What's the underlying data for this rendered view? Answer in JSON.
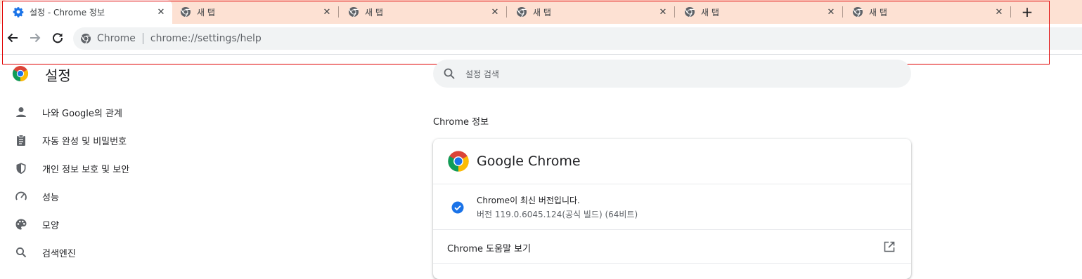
{
  "tabs": [
    {
      "title": "설정 - Chrome 정보",
      "icon": "gear-icon",
      "active": true
    },
    {
      "title": "새 탭",
      "icon": "chrome-icon",
      "active": false
    },
    {
      "title": "새 탭",
      "icon": "chrome-icon",
      "active": false
    },
    {
      "title": "새 탭",
      "icon": "chrome-icon",
      "active": false
    },
    {
      "title": "새 탭",
      "icon": "chrome-icon",
      "active": false
    },
    {
      "title": "새 탭",
      "icon": "chrome-icon",
      "active": false
    }
  ],
  "tab_close_glyph": "✕",
  "new_tab_glyph": "+",
  "omnibox": {
    "chip": "Chrome",
    "url": "chrome://settings/help"
  },
  "settings": {
    "title": "설정",
    "search_placeholder": "설정 검색",
    "nav": [
      {
        "label": "나와 Google의 관계",
        "icon": "person-icon"
      },
      {
        "label": "자동 완성 및 비밀번호",
        "icon": "clipboard-icon"
      },
      {
        "label": "개인 정보 보호 및 보안",
        "icon": "shield-icon"
      },
      {
        "label": "성능",
        "icon": "speedometer-icon"
      },
      {
        "label": "모양",
        "icon": "palette-icon"
      },
      {
        "label": "검색엔진",
        "icon": "search-icon"
      }
    ]
  },
  "about": {
    "section_title": "Chrome 정보",
    "product_name": "Google Chrome",
    "status": "Chrome이 최신 버전입니다.",
    "version": "버전 119.0.6045.124(공식 빌드) (64비트)",
    "help_label": "Chrome 도움말 보기"
  },
  "colors": {
    "tabstrip_bg": "#fde1d3",
    "accent_blue": "#1a73e8",
    "highlight_frame": "#e00000"
  }
}
